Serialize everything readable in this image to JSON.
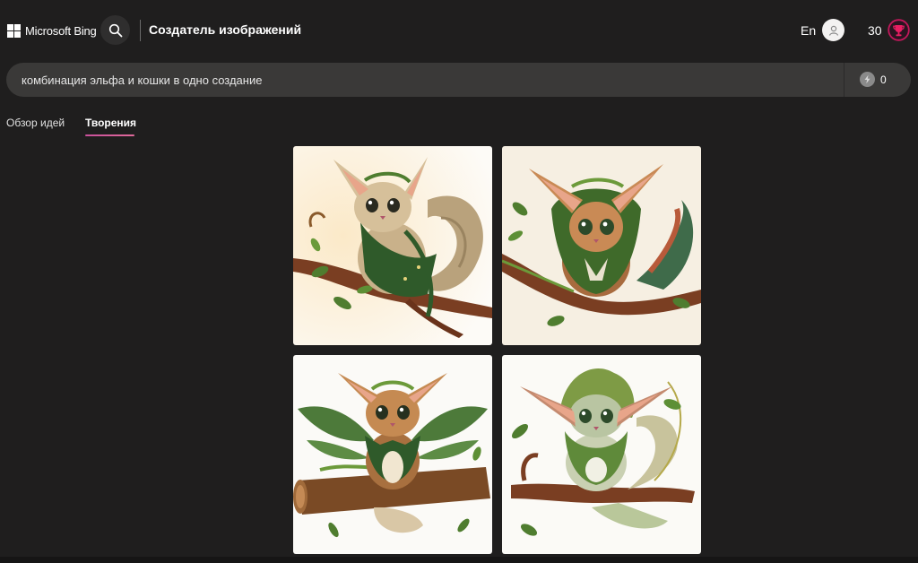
{
  "header": {
    "brand": "Microsoft Bing",
    "title": "Создатель изображений",
    "language": "En",
    "rewards_count": "30"
  },
  "prompt": {
    "value": "комбинация эльфа и кошки в одно создание",
    "boosts": "0"
  },
  "tabs": [
    {
      "label": "Обзор идей",
      "active": false
    },
    {
      "label": "Творения",
      "active": true
    }
  ],
  "results": [
    {
      "icon": "elf-cat-illustration"
    },
    {
      "icon": "elf-cat-illustration"
    },
    {
      "icon": "elf-cat-illustration"
    },
    {
      "icon": "elf-cat-illustration"
    }
  ],
  "colors": {
    "background": "#1f1e1e",
    "prompt_bar": "#3a3938",
    "tab_accent": "#c8509a",
    "rewards_accent": "#c2185b"
  }
}
